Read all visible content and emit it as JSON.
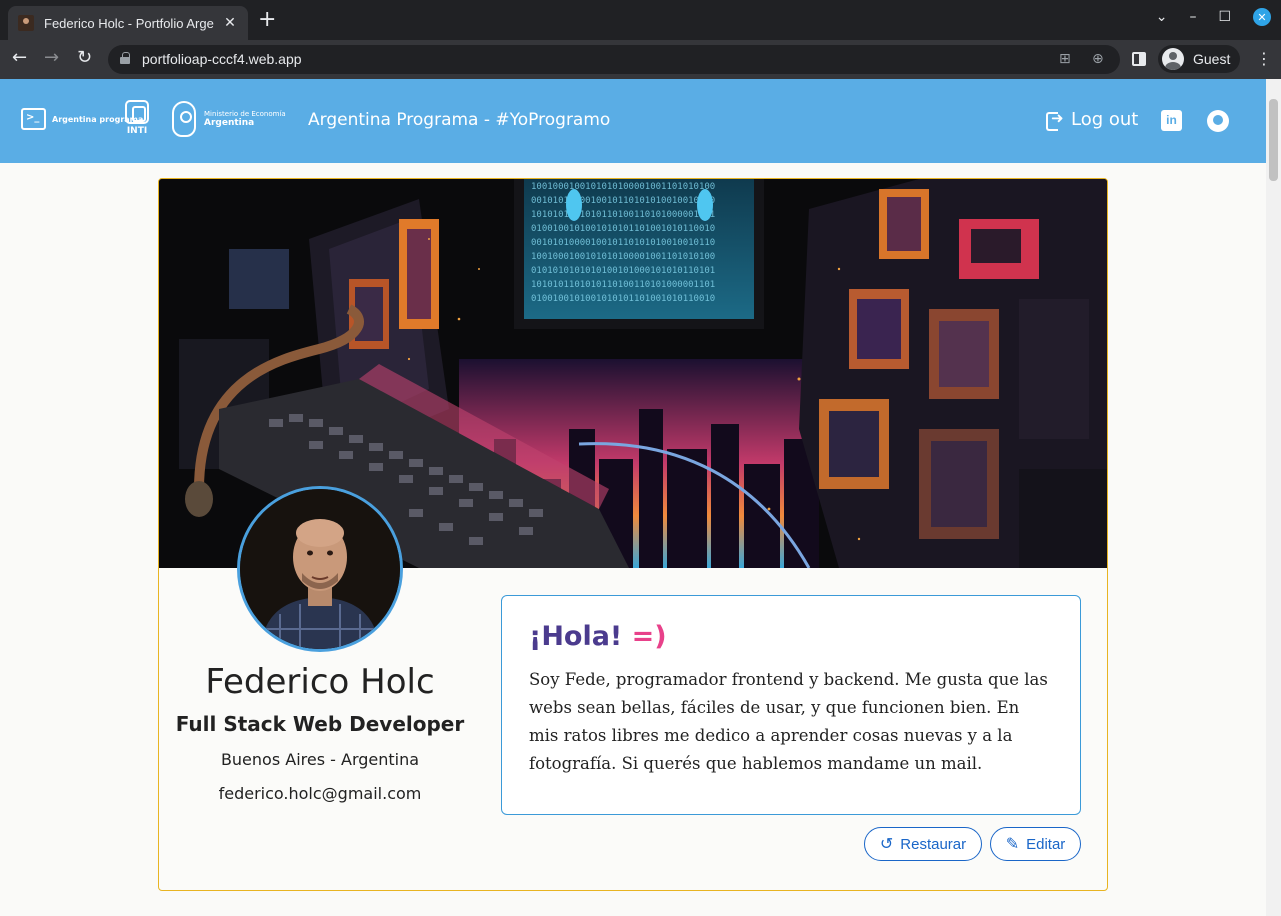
{
  "browser": {
    "tab_title": "Federico Holc - Portfolio Arge",
    "url": "portfolioap-cccf4.web.app",
    "profile_name": "Guest"
  },
  "header": {
    "title": "Argentina Programa - #YoProgramo",
    "logo_ap_text": "Argentina programa",
    "logo_inti_text": "INTI",
    "logo_min_line1": "Ministerio de Economía",
    "logo_min_line2": "Argentina",
    "logout_label": "Log out",
    "linkedin_label": "in",
    "accent_color": "#5aade5"
  },
  "profile": {
    "name": "Federico Holc",
    "role": "Full Stack Web Developer",
    "location": "Buenos Aires - Argentina",
    "email": "federico.holc@gmail.com"
  },
  "about": {
    "greeting": "¡Hola!",
    "greeting_smile": "=)",
    "text": "Soy Fede, programador frontend y backend. Me gusta que las webs sean bellas, fáciles de usar, y que funcionen bien. En mis ratos libres me dedico a aprender cosas nuevas y a la fotografía. Si querés que hablemos mandame un mail."
  },
  "actions": {
    "restore_label": "Restaurar",
    "edit_label": "Editar"
  },
  "icons": {
    "tab_close": "close-icon",
    "logout": "logout-icon",
    "linkedin": "linkedin-icon",
    "github": "github-icon",
    "restore": "undo-icon",
    "edit": "pencil-icon"
  }
}
